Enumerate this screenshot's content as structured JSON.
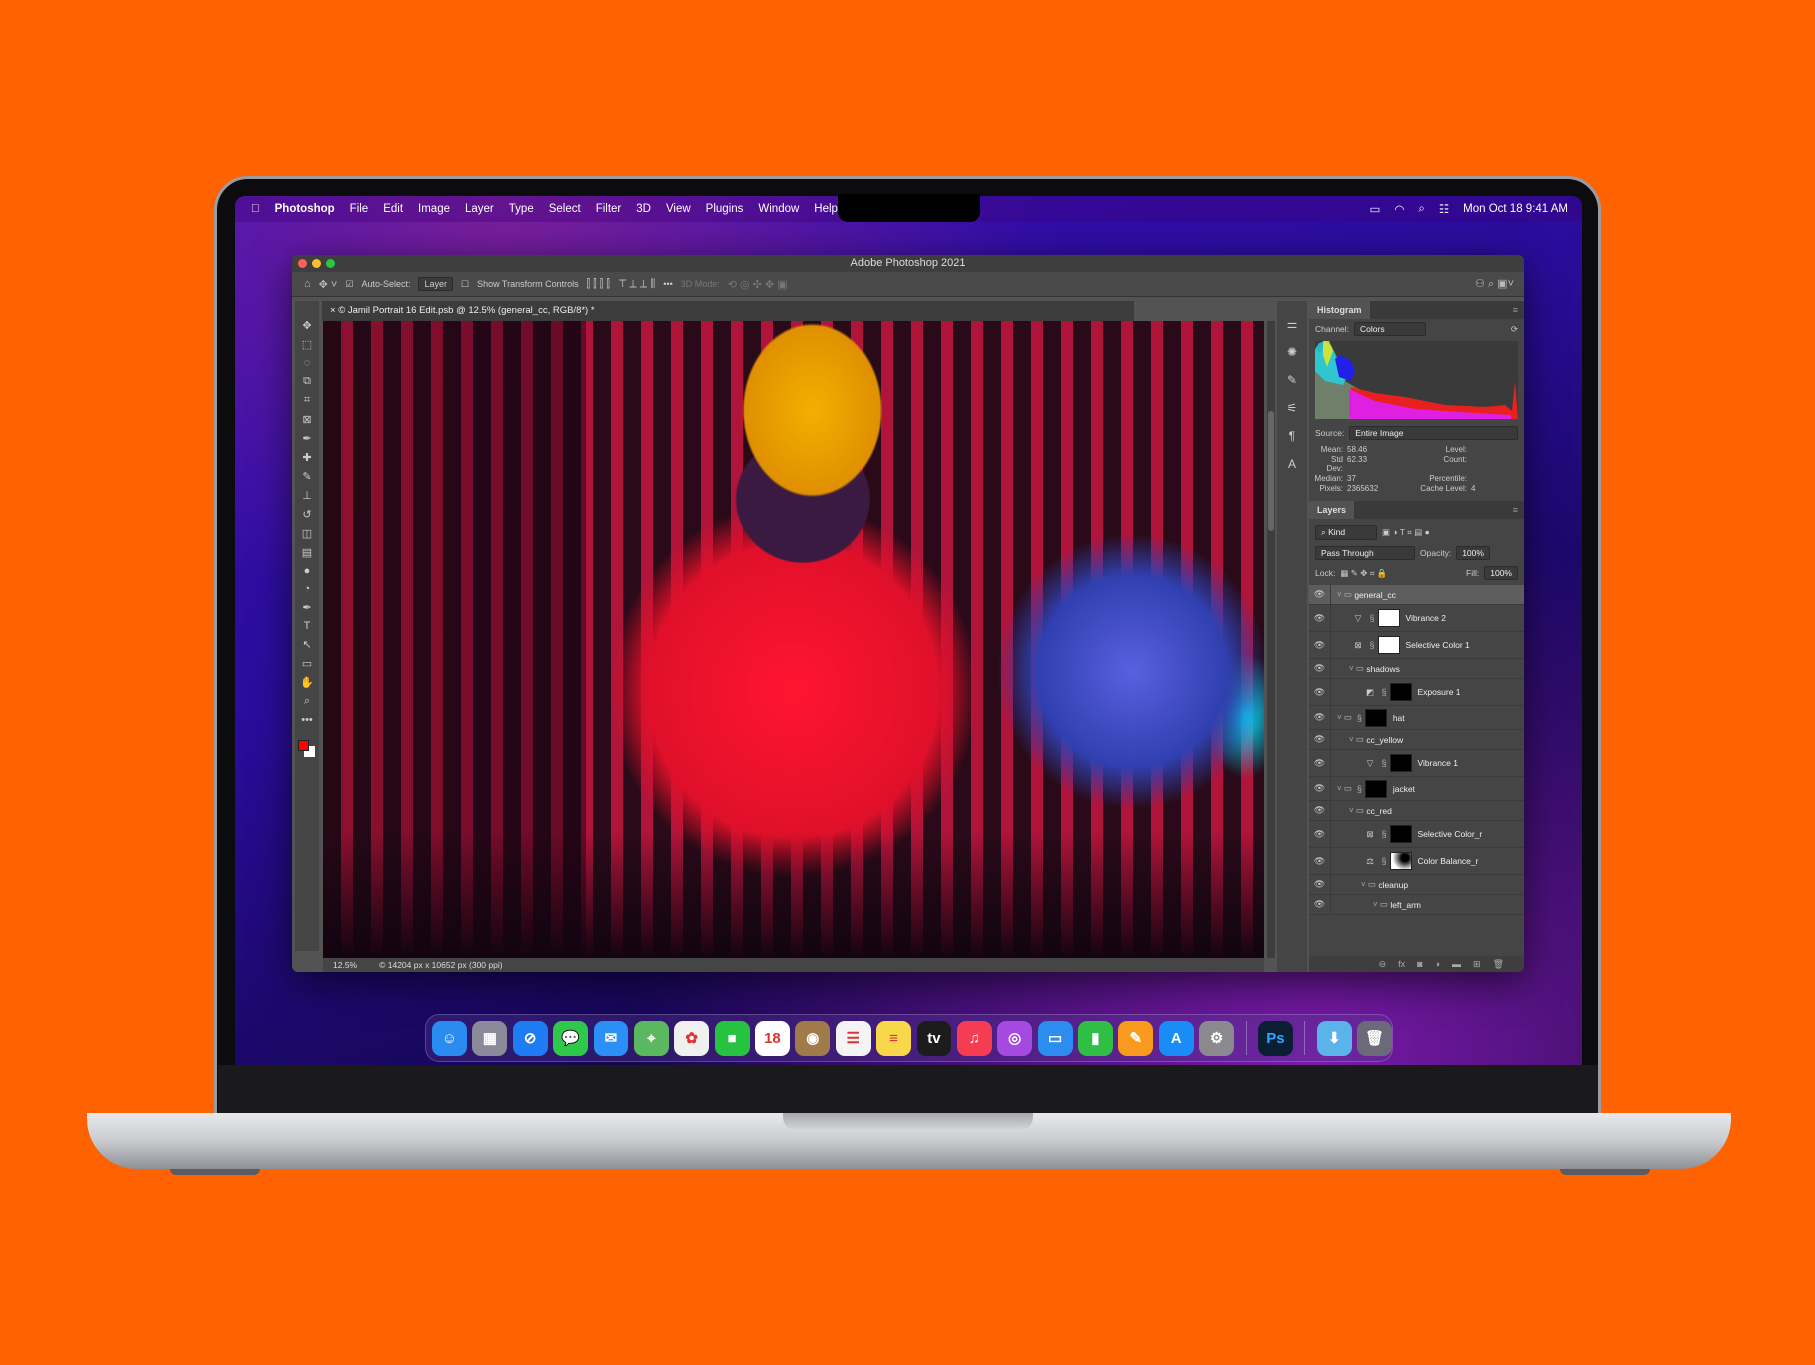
{
  "menubar": {
    "apple": "",
    "app": "Photoshop",
    "items": [
      "File",
      "Edit",
      "Image",
      "Layer",
      "Type",
      "Select",
      "Filter",
      "3D",
      "View",
      "Plugins",
      "Window",
      "Help"
    ],
    "clock": "Mon Oct 18  9:41 AM"
  },
  "window": {
    "title": "Adobe Photoshop 2021"
  },
  "options": {
    "auto_select_label": "Auto-Select:",
    "auto_select_value": "Layer",
    "transform_label": "Show Transform Controls",
    "mode_3d": "3D Mode:",
    "more": "•••"
  },
  "document": {
    "tab": "© Jamil Portrait 16 Edit.psb @ 12.5% (general_cc, RGB/8*) *",
    "zoom": "12.5%",
    "info": "© 14204 px x 10652 px (300 ppi)"
  },
  "histogram": {
    "title": "Histogram",
    "channel_label": "Channel:",
    "channel": "Colors",
    "source_label": "Source:",
    "source": "Entire Image",
    "stats": [
      [
        "Mean:",
        "58.46",
        "Level:",
        ""
      ],
      [
        "Std Dev:",
        "62.33",
        "Count:",
        ""
      ],
      [
        "Median:",
        "37",
        "Percentile:",
        ""
      ],
      [
        "Pixels:",
        "2365632",
        "Cache Level:",
        "4"
      ]
    ]
  },
  "layers": {
    "title": "Layers",
    "kind": "Kind",
    "blend": "Pass Through",
    "opacity_label": "Opacity:",
    "opacity": "100%",
    "lock_label": "Lock:",
    "fill_label": "Fill:",
    "fill": "100%",
    "items": [
      {
        "name": "general_cc",
        "type": "group",
        "indent": 0,
        "selected": true
      },
      {
        "name": "Vibrance 2",
        "type": "vibrance",
        "indent": 1,
        "mask": "white"
      },
      {
        "name": "Selective Color 1",
        "type": "selective",
        "indent": 1,
        "mask": "white"
      },
      {
        "name": "shadows",
        "type": "group",
        "indent": 1
      },
      {
        "name": "Exposure 1",
        "type": "exposure",
        "indent": 2,
        "mask": "black"
      },
      {
        "name": "hat",
        "type": "group",
        "indent": 0,
        "mask": "black"
      },
      {
        "name": "cc_yellow",
        "type": "group",
        "indent": 1
      },
      {
        "name": "Vibrance 1",
        "type": "vibrance",
        "indent": 2,
        "mask": "black"
      },
      {
        "name": "jacket",
        "type": "group",
        "indent": 0,
        "mask": "black"
      },
      {
        "name": "cc_red",
        "type": "group",
        "indent": 1
      },
      {
        "name": "Selective Color_r",
        "type": "selective",
        "indent": 2,
        "mask": "black"
      },
      {
        "name": "Color Balance_r",
        "type": "balance",
        "indent": 2,
        "mask": "grad"
      },
      {
        "name": "cleanup",
        "type": "group",
        "indent": 2
      },
      {
        "name": "left_arm",
        "type": "group",
        "indent": 3
      }
    ]
  },
  "dock": {
    "apps": [
      {
        "name": "Finder",
        "glyph": "☺",
        "color": "#2a8cf0"
      },
      {
        "name": "Launchpad",
        "glyph": "▦",
        "color": "#8a8a9a"
      },
      {
        "name": "Safari",
        "glyph": "⊘",
        "color": "#1e7cf2"
      },
      {
        "name": "Messages",
        "glyph": "💬",
        "color": "#2ec84a"
      },
      {
        "name": "Mail",
        "glyph": "✉",
        "color": "#2a90f5"
      },
      {
        "name": "Maps",
        "glyph": "⌖",
        "color": "#5ab860"
      },
      {
        "name": "Photos",
        "glyph": "✿",
        "color": "#f0f0f0"
      },
      {
        "name": "FaceTime",
        "glyph": "■",
        "color": "#27c23f"
      },
      {
        "name": "Calendar",
        "glyph": "18",
        "color": "#ffffff"
      },
      {
        "name": "Contacts",
        "glyph": "◉",
        "color": "#a07a48"
      },
      {
        "name": "Reminders",
        "glyph": "☰",
        "color": "#f4f4f4"
      },
      {
        "name": "Notes",
        "glyph": "≡",
        "color": "#f8d84a"
      },
      {
        "name": "TV",
        "glyph": "tv",
        "color": "#1c1c1c"
      },
      {
        "name": "Music",
        "glyph": "♫",
        "color": "#f43c52"
      },
      {
        "name": "Podcasts",
        "glyph": "◎",
        "color": "#a44ae0"
      },
      {
        "name": "Keynote",
        "glyph": "▭",
        "color": "#2d8cf0"
      },
      {
        "name": "Numbers",
        "glyph": "▮",
        "color": "#2fbf45"
      },
      {
        "name": "Pages",
        "glyph": "✎",
        "color": "#f79a1e"
      },
      {
        "name": "App Store",
        "glyph": "A",
        "color": "#1a8cf5"
      },
      {
        "name": "System Preferences",
        "glyph": "⚙",
        "color": "#8a8a8e"
      }
    ],
    "ps": {
      "name": "Photoshop",
      "glyph": "Ps",
      "color": "#0a1e34"
    },
    "folder": {
      "name": "Downloads",
      "glyph": "⬇",
      "color": "#5ab4ea"
    },
    "trash": {
      "name": "Trash",
      "glyph": "🗑",
      "color": "#6a6a78"
    }
  },
  "colors": {
    "background": "#ff6200",
    "ps_panel": "#535353",
    "accent": "#31a8ff"
  }
}
